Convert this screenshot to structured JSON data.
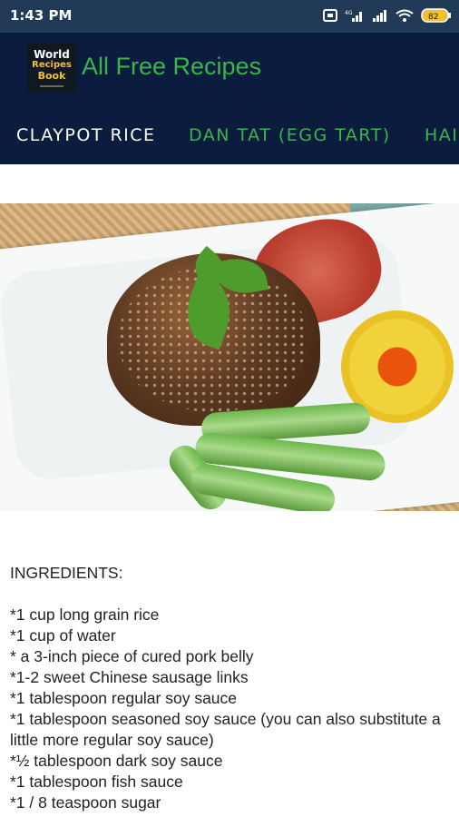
{
  "status_bar": {
    "time": "1:43 PM",
    "battery": "82"
  },
  "app_bar": {
    "logo_lines": [
      "World",
      "Recipes",
      "Book"
    ],
    "title": "All Free Recipes"
  },
  "tabs": [
    {
      "label": "CLAYPOT RICE",
      "active": true
    },
    {
      "label": "DAN TAT (EGG TART)",
      "active": false
    },
    {
      "label": "HAI",
      "active": false
    }
  ],
  "recipe": {
    "heading": "INGREDIENTS:",
    "ingredients": [
      "*1 cup long grain rice",
      "*1 cup of water",
      "* a 3-inch piece of cured pork belly",
      "*1-2 sweet Chinese sausage links",
      "*1 tablespoon regular soy sauce",
      "*1 tablespoon seasoned soy sauce (you can also substitute a little more regular soy sauce)",
      "*½ tablespoon dark soy sauce",
      "*1 tablespoon fish sauce",
      "*1 / 8 teaspoon sugar"
    ]
  },
  "colors": {
    "status_bar": "#213a58",
    "app_bar": "#0c1c3f",
    "accent_green": "#39b54a"
  }
}
